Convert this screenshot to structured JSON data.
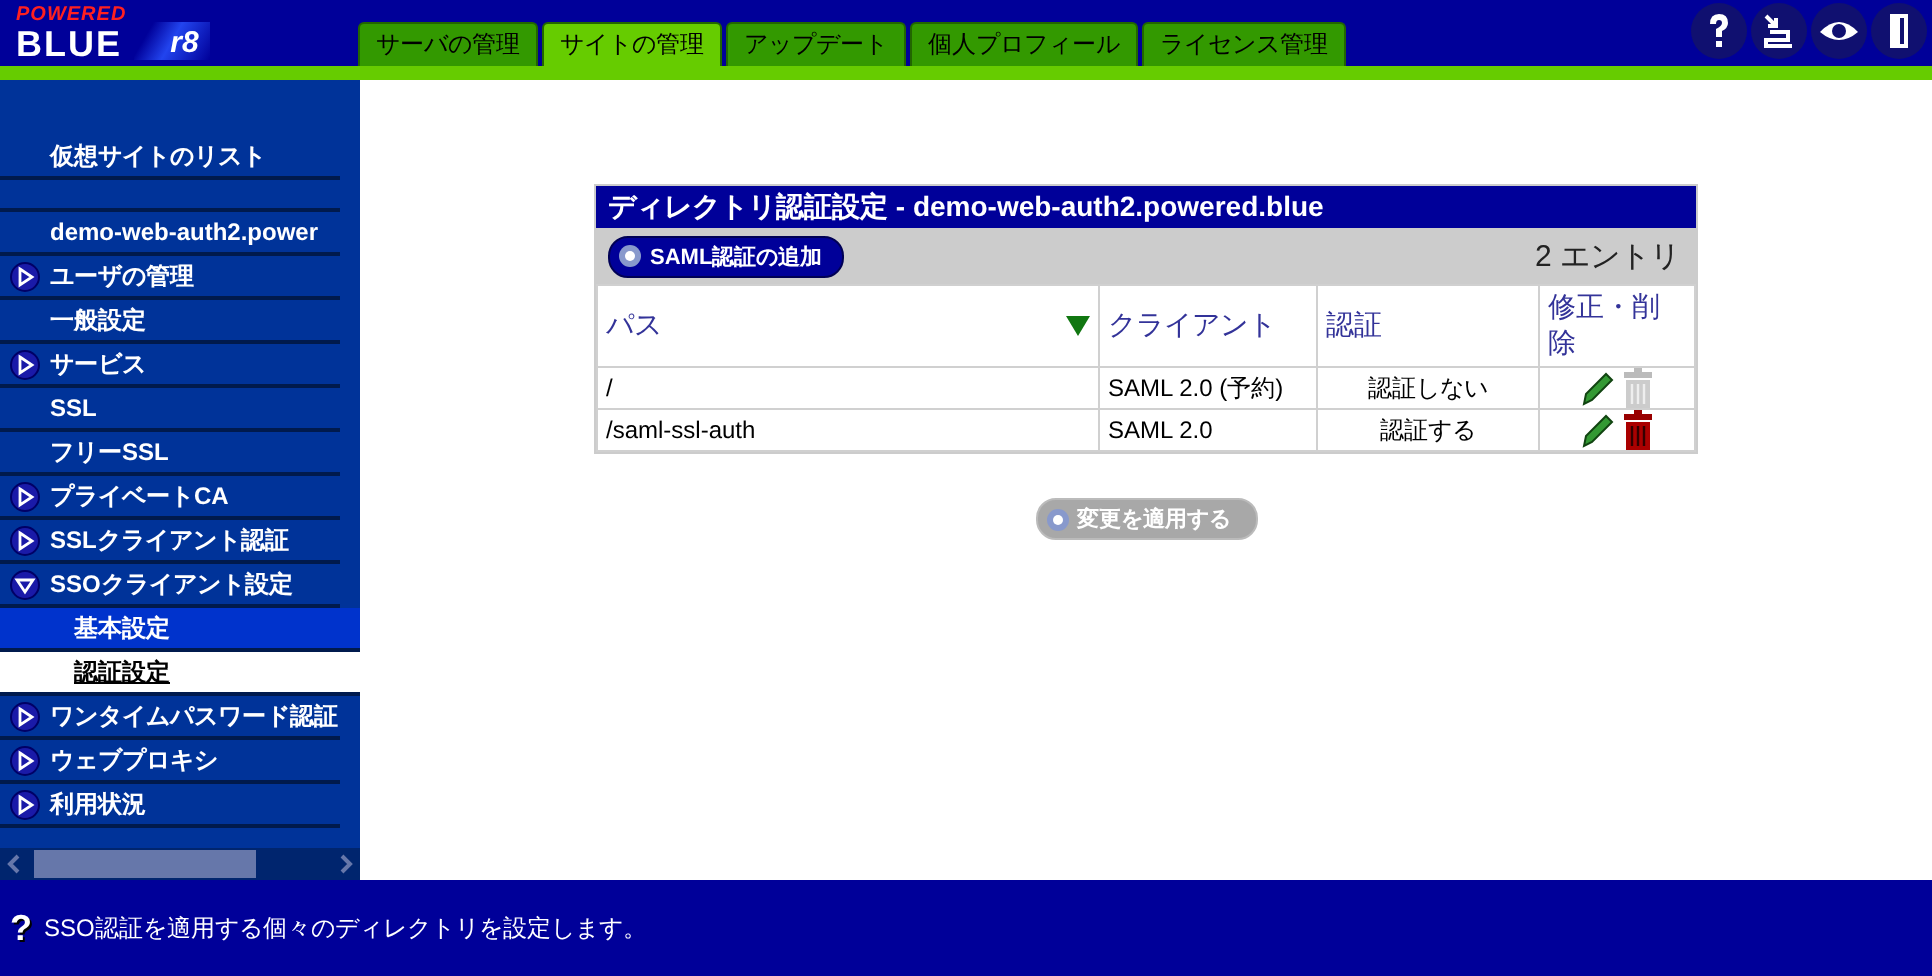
{
  "logo": {
    "top": "POWERED",
    "main": "BLUE",
    "version": "r8"
  },
  "tabs": [
    {
      "label": "サーバの管理",
      "selected": false
    },
    {
      "label": "サイトの管理",
      "selected": true
    },
    {
      "label": "アップデート",
      "selected": false
    },
    {
      "label": "個人プロフィール",
      "selected": false
    },
    {
      "label": "ライセンス管理",
      "selected": false
    }
  ],
  "sidebar": {
    "items": [
      {
        "kind": "plain",
        "label": "仮想サイトのリスト"
      },
      {
        "kind": "blank"
      },
      {
        "kind": "plain",
        "label": "demo-web-auth2.power"
      },
      {
        "kind": "group",
        "label": "ユーザの管理",
        "expanded": false
      },
      {
        "kind": "plain",
        "label": "一般設定"
      },
      {
        "kind": "group",
        "label": "サービス",
        "expanded": false
      },
      {
        "kind": "plain",
        "label": "SSL"
      },
      {
        "kind": "plain",
        "label": "フリーSSL"
      },
      {
        "kind": "group",
        "label": "プライベートCA",
        "expanded": false
      },
      {
        "kind": "group",
        "label": "SSLクライアント認証",
        "expanded": false
      },
      {
        "kind": "group",
        "label": "SSOクライアント設定",
        "expanded": true,
        "children": [
          {
            "label": "基本設定",
            "selected": false
          },
          {
            "label": "認証設定",
            "selected": true
          }
        ]
      },
      {
        "kind": "group",
        "label": "ワンタイムパスワード認証",
        "expanded": false
      },
      {
        "kind": "group",
        "label": "ウェブプロキシ",
        "expanded": false
      },
      {
        "kind": "group",
        "label": "利用状況",
        "expanded": false
      }
    ]
  },
  "panel": {
    "title": "ディレクトリ認証設定 - demo-web-auth2.powered.blue",
    "add_button": "SAML認証の追加",
    "count": "2 エントリ",
    "columns": [
      "パス",
      "クライアント",
      "認証",
      "修正・削除"
    ],
    "rows": [
      {
        "path": "/",
        "client": "SAML 2.0 (予約)",
        "auth": "認証しない",
        "deletable": false
      },
      {
        "path": "/saml-ssl-auth",
        "client": "SAML 2.0",
        "auth": "認証する",
        "deletable": true
      }
    ],
    "apply_button": {
      "label": "変更を適用する",
      "disabled": true
    }
  },
  "status_bar": {
    "icon": "?",
    "text": "SSO認証を適用する個々のディレクトリを設定します。"
  }
}
